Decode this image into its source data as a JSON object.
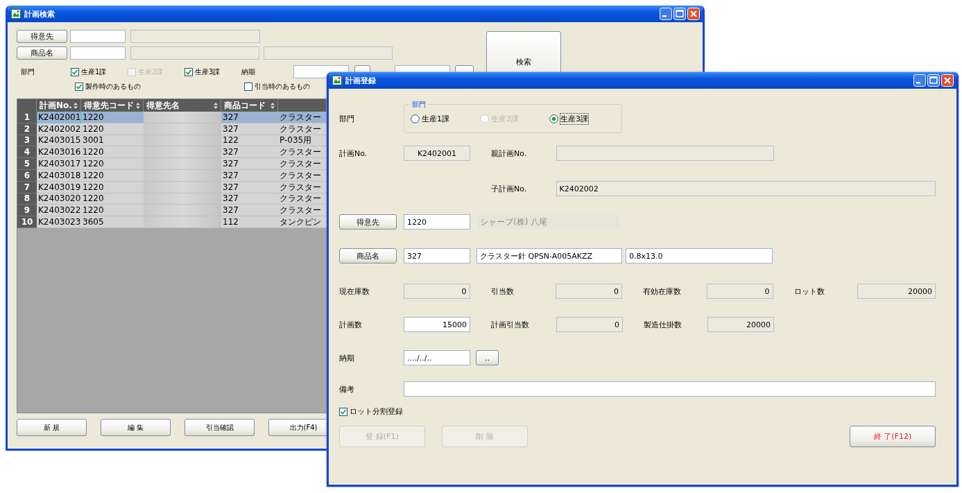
{
  "search_window": {
    "title": "計画検索",
    "customer_button": "得意先",
    "product_button": "商品名",
    "department_label": "部門",
    "departments": [
      {
        "label": "生産1課",
        "checked": true,
        "disabled": false
      },
      {
        "label": "生産2課",
        "checked": false,
        "disabled": true
      },
      {
        "label": "生産3課",
        "checked": true,
        "disabled": false
      }
    ],
    "delivery_label": "納期",
    "filters": [
      {
        "label": "製作時のあるもの",
        "checked": true
      },
      {
        "label": "引当時のあるもの",
        "checked": false
      }
    ],
    "search_button": "検索",
    "table": {
      "columns": [
        "計画No.",
        "得意先コード",
        "得意先名",
        "商品コード"
      ],
      "rows": [
        {
          "number": "1",
          "plan_no": "K2402001",
          "customer_code": "1220",
          "product_code": "327",
          "column_5": "クラスター",
          "selected": true
        },
        {
          "number": "2",
          "plan_no": "K2402002",
          "customer_code": "1220",
          "product_code": "327",
          "column_5": "クラスター",
          "selected": false
        },
        {
          "number": "3",
          "plan_no": "K2403015",
          "customer_code": "3001",
          "product_code": "122",
          "column_5": "P-035用",
          "selected": false
        },
        {
          "number": "4",
          "plan_no": "K2403016",
          "customer_code": "1220",
          "product_code": "327",
          "column_5": "クラスター",
          "selected": false
        },
        {
          "number": "5",
          "plan_no": "K2403017",
          "customer_code": "1220",
          "product_code": "327",
          "column_5": "クラスター",
          "selected": false
        },
        {
          "number": "6",
          "plan_no": "K2403018",
          "customer_code": "1220",
          "product_code": "327",
          "column_5": "クラスター",
          "selected": false
        },
        {
          "number": "7",
          "plan_no": "K2403019",
          "customer_code": "1220",
          "product_code": "327",
          "column_5": "クラスター",
          "selected": false
        },
        {
          "number": "8",
          "plan_no": "K2403020",
          "customer_code": "1220",
          "product_code": "327",
          "column_5": "クラスター",
          "selected": false
        },
        {
          "number": "9",
          "plan_no": "K2403022",
          "customer_code": "1220",
          "product_code": "327",
          "column_5": "クラスター",
          "selected": false
        },
        {
          "number": "10",
          "plan_no": "K2403023",
          "customer_code": "3605",
          "product_code": "112",
          "column_5": "タンクピン",
          "selected": false
        }
      ]
    },
    "buttons": [
      {
        "label": "新 規"
      },
      {
        "label": "編 集"
      },
      {
        "label": "引当確認"
      },
      {
        "label": "出力(F4)"
      }
    ]
  },
  "entry_window": {
    "title": "計画登録",
    "department_label": "部門",
    "department_group": {
      "legend": "部門",
      "options": [
        {
          "label": "生産1課",
          "selected": false,
          "disabled": false
        },
        {
          "label": "生産2課",
          "selected": false,
          "disabled": true
        },
        {
          "label": "生産3課",
          "selected": true,
          "disabled": false
        }
      ]
    },
    "plan_no": {
      "label": "計画No.",
      "value": "K2402001"
    },
    "parent_plan_no": {
      "label": "親計画No."
    },
    "child_plan_no": {
      "label": "子計画No.",
      "value": "K2402002"
    },
    "customer": {
      "button": "得意先",
      "code": "1220",
      "name": "シャープ(株) 八尾"
    },
    "product": {
      "button": "商品名",
      "code": "327",
      "name": "クラスター針  QPSN-A005AKZZ",
      "size": "0.8x13.0"
    },
    "stock_row": [
      {
        "label": "現在庫数",
        "value": "0",
        "editable": false
      },
      {
        "label": "引当数",
        "value": "0",
        "editable": false
      },
      {
        "label": "有効在庫数",
        "value": "0",
        "editable": false
      },
      {
        "label": "ロット数",
        "value": "20000",
        "editable": false
      }
    ],
    "plan_row": [
      {
        "label": "計画数",
        "value": "15000",
        "editable": true
      },
      {
        "label": "計画引当数",
        "value": "0",
        "editable": false
      },
      {
        "label": "製造仕掛数",
        "value": "20000",
        "editable": false
      }
    ],
    "delivery": {
      "label": "納期",
      "value": "..../../..",
      "button": ".."
    },
    "remarks": {
      "label": "備考"
    },
    "split_lot": {
      "label": "ロット分割登録",
      "checked": true
    },
    "buttons": [
      {
        "label": "登 録(F1)",
        "disabled": true
      },
      {
        "label": "削 除",
        "disabled": true
      },
      {
        "label": "終 了(F12)",
        "disabled": false,
        "color": "#e02020"
      }
    ]
  }
}
